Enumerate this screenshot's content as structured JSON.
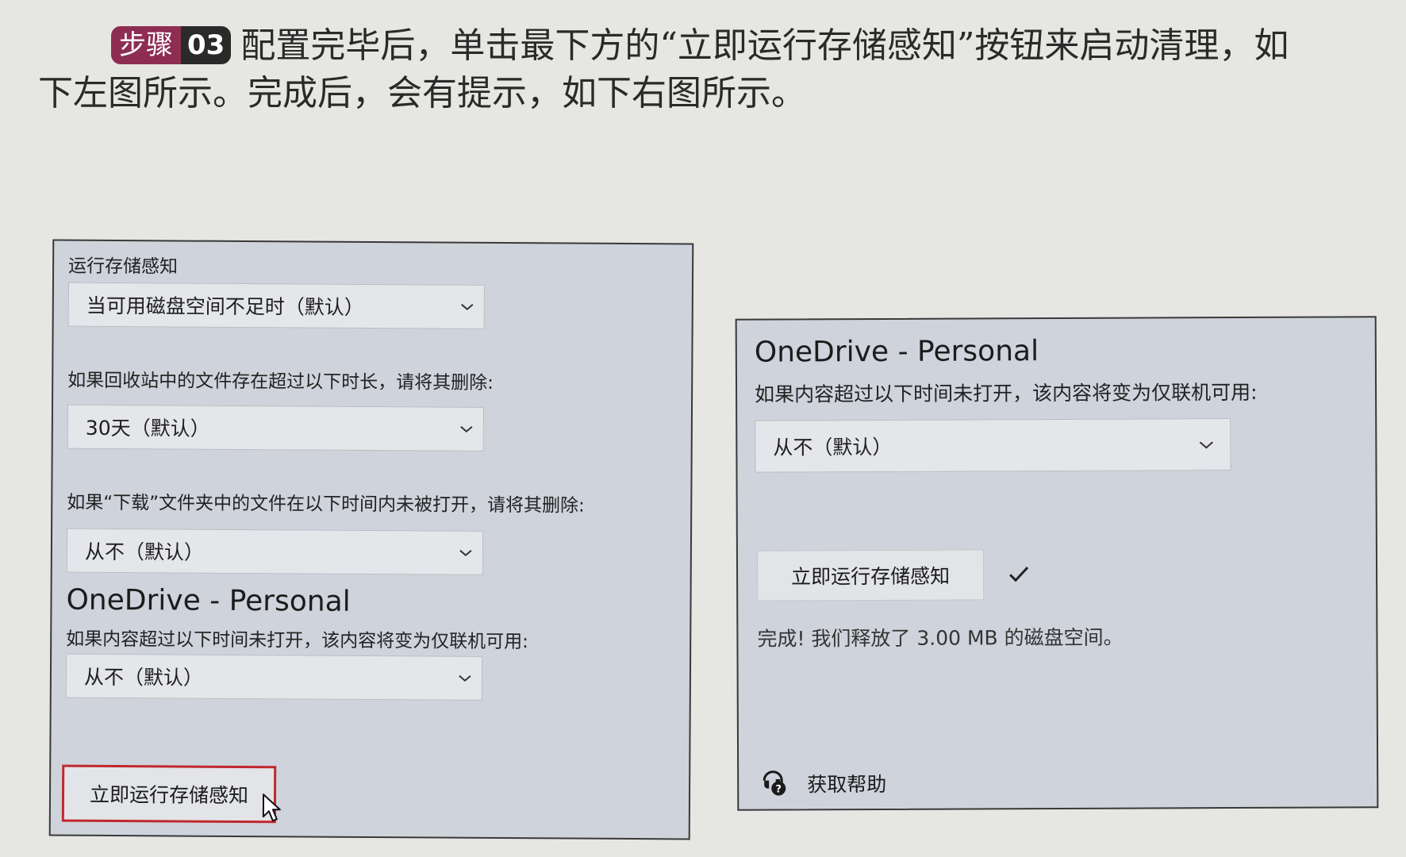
{
  "instruction": {
    "step_label": "步骤",
    "step_number": "03",
    "line1": "配置完毕后，单击最下方的“立即运行存储感知”按钮来启动清理，如",
    "line2": "下左图所示。完成后，会有提示，如下右图所示。"
  },
  "left_screenshot": {
    "run_label": "运行存储感知",
    "run_value": "当可用磁盘空间不足时（默认）",
    "recycle_label": "如果回收站中的文件存在超过以下时长，请将其删除:",
    "recycle_value": "30天（默认）",
    "downloads_label": "如果“下载”文件夹中的文件在以下时间内未被打开，请将其删除:",
    "downloads_value": "从不（默认）",
    "onedrive_title": "OneDrive - Personal",
    "onedrive_label": "如果内容超过以下时间未打开，该内容将变为仅联机可用:",
    "onedrive_value": "从不（默认）",
    "run_now_button": "立即运行存储感知"
  },
  "right_screenshot": {
    "onedrive_title": "OneDrive - Personal",
    "onedrive_label": "如果内容超过以下时间未打开，该内容将变为仅联机可用:",
    "onedrive_value": "从不（默认）",
    "run_now_button": "立即运行存储感知",
    "result_text": "完成! 我们释放了 3.00 MB 的磁盘空间。",
    "help_link": "获取帮助"
  },
  "colors": {
    "step_badge": "#8e2d52",
    "highlight_border": "#c1272d",
    "panel_background": "#cfd3db"
  },
  "icons": [
    "chevron-down-icon",
    "cursor-icon",
    "checkmark-icon",
    "help-icon"
  ]
}
